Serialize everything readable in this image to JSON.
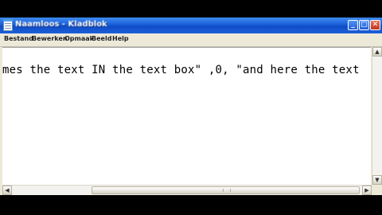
{
  "window": {
    "title": "Naamloos - Kladblok"
  },
  "titlebar": {
    "minimize_glyph": "_",
    "maximize_glyph": "□",
    "close_glyph": "✕"
  },
  "menu": {
    "items": [
      {
        "label": "Bestand"
      },
      {
        "label": "Bewerken"
      },
      {
        "label": "Opmaak"
      },
      {
        "label": "Beeld"
      },
      {
        "label": "Help"
      }
    ]
  },
  "editor": {
    "content": "mes the text IN the text box\" ,0, \"and here the text"
  },
  "scrollbars": {
    "up_glyph": "▲",
    "down_glyph": "▼",
    "left_glyph": "◀",
    "right_glyph": "▶"
  },
  "colors": {
    "titlebar_accent": "#1a5fd8",
    "close_button": "#c2351a",
    "window_chrome": "#ece9d8",
    "editor_background": "#ffffff"
  }
}
